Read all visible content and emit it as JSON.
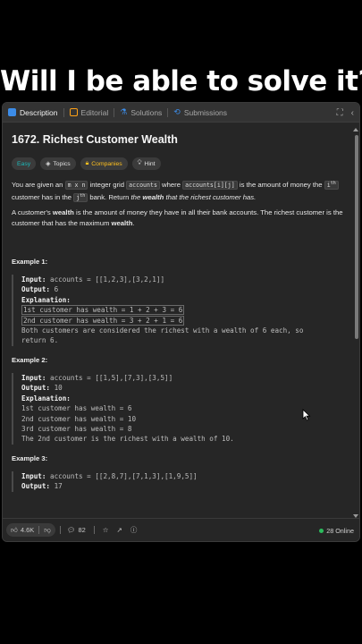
{
  "headline": "Will I be able to solve it?",
  "tabs": [
    {
      "label": "Description",
      "icon": "description-icon",
      "color": "#3c8ce7"
    },
    {
      "label": "Editorial",
      "icon": "editorial-icon",
      "color": "#ffa116"
    },
    {
      "label": "Solutions",
      "icon": "solutions-icon",
      "color": "#3c8ce7"
    },
    {
      "label": "Submissions",
      "icon": "submissions-icon",
      "color": "#3c8ce7"
    }
  ],
  "problem": {
    "title": "1672. Richest Customer Wealth",
    "difficulty": "Easy",
    "chips": {
      "topics": "Topics",
      "companies": "Companies",
      "hint": "Hint"
    }
  },
  "description": {
    "p1_a": "You are given an ",
    "p1_code_grid": "m x n",
    "p1_b": " integer grid ",
    "p1_code_accounts": "accounts",
    "p1_c": " where ",
    "p1_code_index": "accounts[i][j]",
    "p1_d": " is the amount of money the ",
    "p1_code_i": "i",
    "p1_sup_i": "th",
    "p1_e": " customer has in the ",
    "p1_code_j": "j",
    "p1_sup_j": "th",
    "p1_f": " bank. Return ",
    "p1_g": "the ",
    "p1_h": "wealth",
    "p1_k": " that the richest customer has.",
    "p2_a": "A customer's ",
    "p2_b": "wealth",
    "p2_c": " is the amount of money they have in all their bank accounts. The richest customer is the customer that has the maximum ",
    "p2_d": "wealth",
    "p2_e": "."
  },
  "labels": {
    "input": "Input:",
    "output": "Output:",
    "explanation": "Explanation:"
  },
  "examples": [
    {
      "title": "Example 1:",
      "input": "accounts = [[1,2,3],[3,2,1]]",
      "output": "6",
      "explanation": [
        "1st customer has wealth = 1 + 2 + 3 = 6",
        "2nd customer has wealth = 3 + 2 + 1 = 6",
        "Both customers are considered the richest with a wealth of 6 each, so",
        "return 6."
      ]
    },
    {
      "title": "Example 2:",
      "input": "accounts = [[1,5],[7,3],[3,5]]",
      "output": "10",
      "explanation": [
        "1st customer has wealth = 6",
        "2nd customer has wealth = 10",
        "3rd customer has wealth = 8",
        "The 2nd customer is the richest with a wealth of 10."
      ]
    },
    {
      "title": "Example 3:",
      "input": "accounts = [[2,8,7],[7,1,3],[1,9,5]]",
      "output": "17"
    }
  ],
  "footer": {
    "likes": "4.6K",
    "comments": "82",
    "online": "28 Online"
  },
  "colors": {
    "easy": "#1cb8b8",
    "companies": "#ffc01e",
    "online_dot": "#2cbb5d"
  }
}
